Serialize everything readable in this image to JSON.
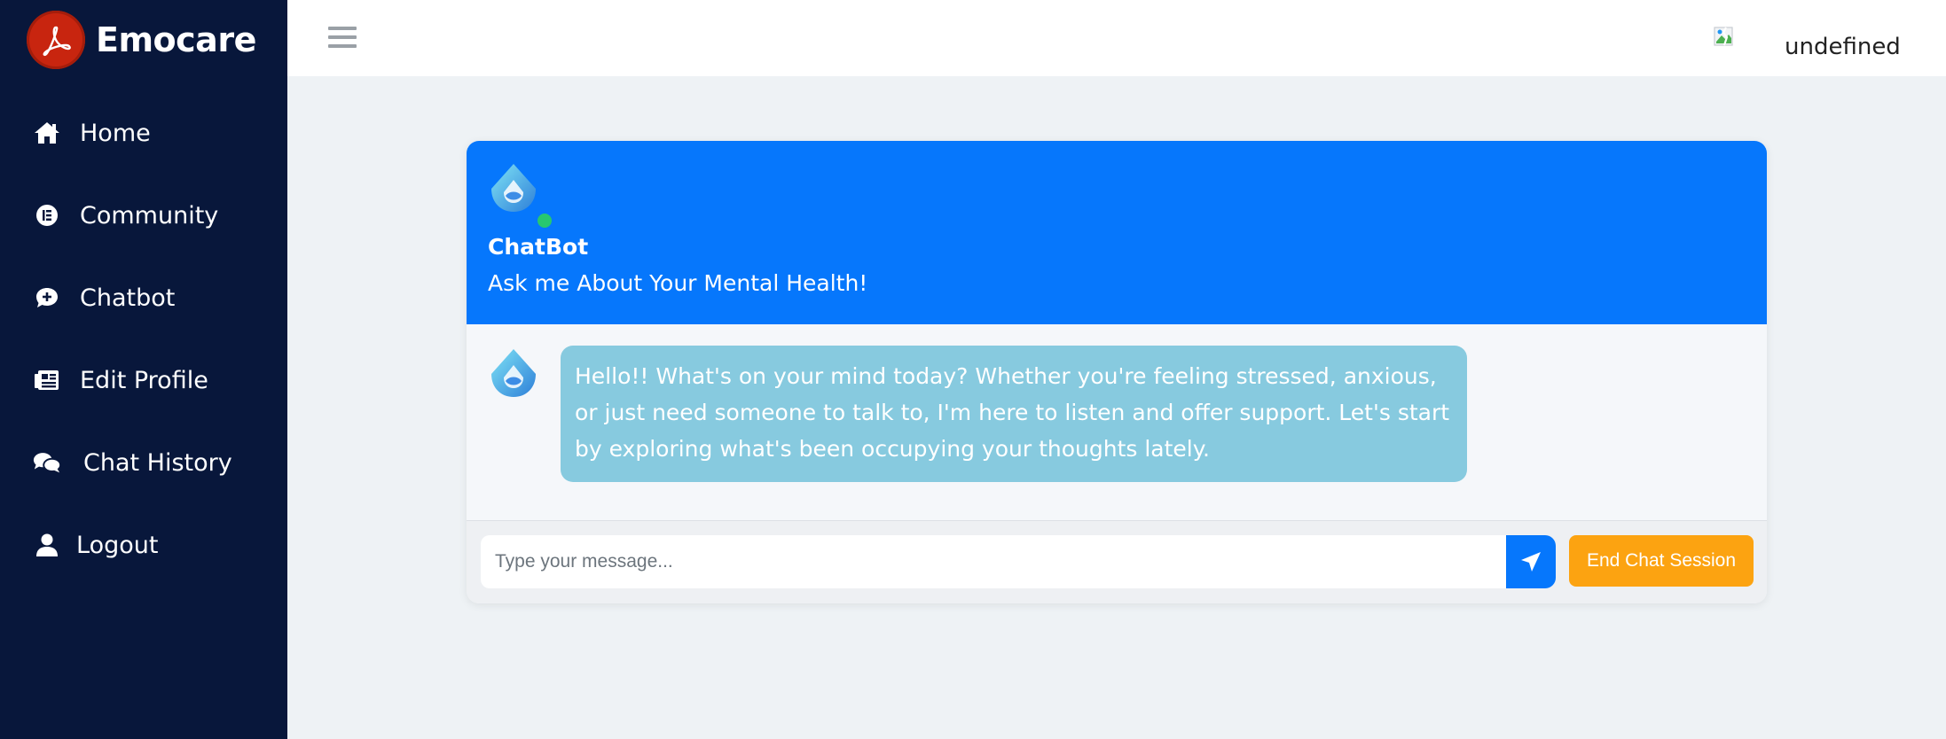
{
  "brand": {
    "name": "Emocare",
    "logo_icon": "acrobat-logo-icon",
    "logo_color": "#c8250f"
  },
  "sidebar": {
    "bg_color": "#08173b",
    "items": [
      {
        "label": "Home",
        "icon": "home-icon"
      },
      {
        "label": "Community",
        "icon": "community-icon"
      },
      {
        "label": "Chatbot",
        "icon": "chat-bubble-icon"
      },
      {
        "label": "Edit Profile",
        "icon": "profile-card-icon"
      },
      {
        "label": "Chat History",
        "icon": "comments-icon"
      },
      {
        "label": "Logout",
        "icon": "user-icon"
      }
    ]
  },
  "topbar": {
    "menu_icon": "hamburger-icon",
    "user_name": "undefined",
    "avatar_icon": "broken-image-icon"
  },
  "chat": {
    "header_color": "#0677fc",
    "bot_name": "ChatBot",
    "tagline": "Ask me About Your Mental Health!",
    "status": "online",
    "messages": [
      {
        "sender": "bot",
        "text": "Hello!! What's on your mind today? Whether you're feeling stressed, anxious, or just need someone to talk to, I'm here to listen and offer support. Let's start by exploring what's been occupying your thoughts lately."
      }
    ],
    "bubble_color": "#87cadf",
    "input_placeholder": "Type your message...",
    "input_value": "",
    "send_icon": "paper-plane-icon",
    "end_button_label": "End Chat Session",
    "end_button_color": "#fca311"
  }
}
